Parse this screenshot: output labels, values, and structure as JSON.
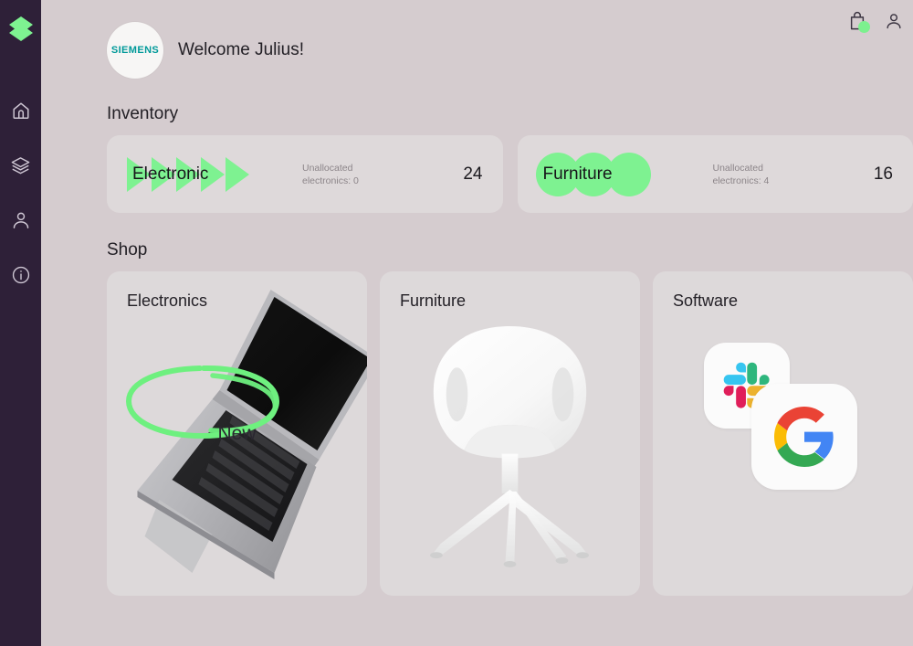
{
  "brand": {
    "logo_icon": "stacked-diamond-logo"
  },
  "sidebar": {
    "items": [
      {
        "icon": "home-icon",
        "name": "home"
      },
      {
        "icon": "layers-icon",
        "name": "inventory"
      },
      {
        "icon": "person-icon",
        "name": "account"
      },
      {
        "icon": "info-icon",
        "name": "info"
      }
    ]
  },
  "topbar": {
    "cart_icon": "shopping-bag-icon",
    "cart_badge": "",
    "account_icon": "person-icon"
  },
  "header": {
    "avatar_text": "SIEMENS",
    "avatar_icon": "siemens-logo",
    "welcome": "Welcome Julius!"
  },
  "inventory": {
    "title": "Inventory",
    "cards": [
      {
        "label": "Electronic",
        "sub": "Unallocated\nelectronics: 0",
        "count": "24",
        "deco": "green-arrows"
      },
      {
        "label": "Furniture",
        "sub": "Unallocated\nelectronics: 4",
        "count": "16",
        "deco": "green-circles"
      }
    ]
  },
  "shop": {
    "title": "Shop",
    "cards": [
      {
        "title": "Electronics",
        "art": "laptop-image",
        "annotation": "New"
      },
      {
        "title": "Furniture",
        "art": "chair-image"
      },
      {
        "title": "Software",
        "art": "app-icons",
        "apps": [
          "Slack",
          "Google"
        ]
      }
    ]
  },
  "colors": {
    "background": "#d5cccf",
    "sidebar": "#2e2038",
    "card": "#ded9da",
    "accent_green": "#7ef291",
    "siemens_teal": "#009999",
    "text": "#232026",
    "muted_text": "#8c8589"
  }
}
